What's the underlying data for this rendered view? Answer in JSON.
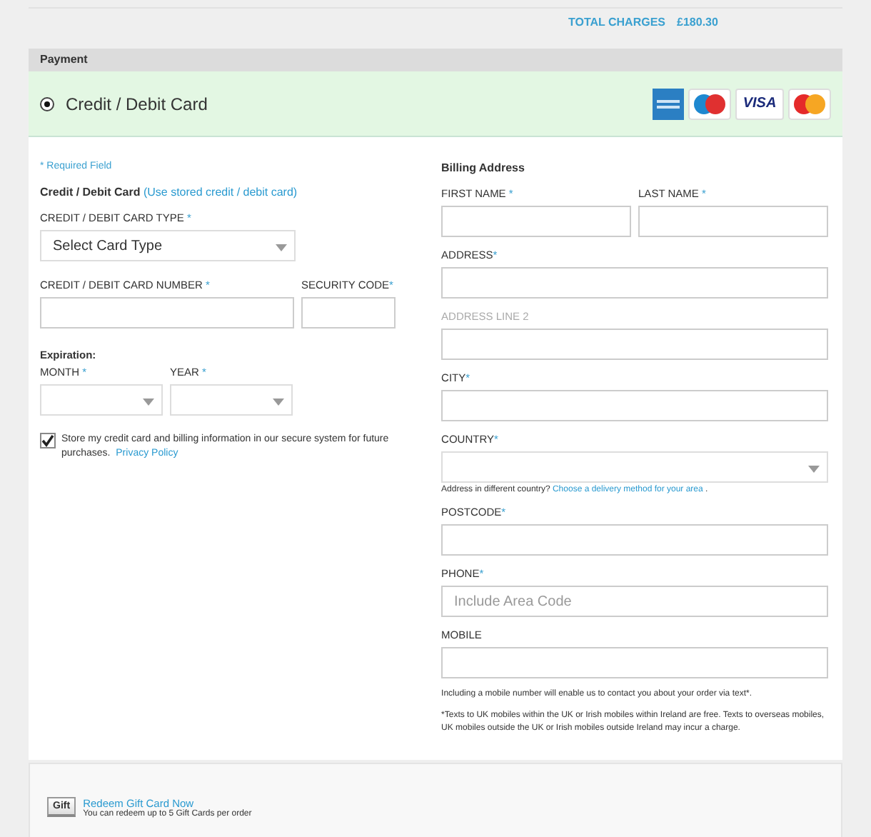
{
  "total": {
    "label": "TOTAL CHARGES",
    "amount": "£180.30"
  },
  "section_title": "Payment",
  "payment_option": {
    "label": "Credit / Debit Card",
    "selected": true,
    "logos": [
      {
        "kind": "amex"
      },
      {
        "kind": "maestro"
      },
      {
        "kind": "visa",
        "text": "VISA"
      },
      {
        "kind": "mastercard"
      }
    ]
  },
  "required_note": "* Required Field",
  "card": {
    "heading": "Credit / Debit Card",
    "stored_link": "(Use stored credit / debit card)",
    "type_field": {
      "label": "CREDIT / DEBIT CARD TYPE",
      "mark": "*",
      "value": "Select Card Type"
    },
    "number_field": {
      "label": "CREDIT / DEBIT CARD NUMBER",
      "mark": "*"
    },
    "security_field": {
      "label": "SECURITY CODE",
      "mark": "*"
    },
    "expiration": "Expiration:",
    "month_field": {
      "label": "MONTH",
      "mark": "*"
    },
    "year_field": {
      "label": "YEAR",
      "mark": "*"
    },
    "store": {
      "checked": true,
      "text": "Store my credit card and billing information in our secure system for future purchases.",
      "link": "Privacy Policy"
    }
  },
  "billing": {
    "heading": "Billing Address",
    "fields": [
      {
        "kind": "pair",
        "items": [
          {
            "label": "FIRST NAME",
            "mark": "*"
          },
          {
            "label": "LAST NAME",
            "mark": "*"
          }
        ]
      },
      {
        "kind": "input",
        "label": "ADDRESS",
        "mark": "*",
        "dimmed": false
      },
      {
        "kind": "input",
        "label": "ADDRESS LINE 2",
        "dimmed": true
      },
      {
        "kind": "input",
        "label": "CITY",
        "mark": "*",
        "dimmed": false
      },
      {
        "kind": "select",
        "label": "COUNTRY",
        "mark": "*",
        "dimmed": false
      },
      {
        "kind": "note",
        "text": "Address in different country?",
        "link": "Choose a delivery method for your area",
        "after": "."
      },
      {
        "kind": "input",
        "label": "POSTCODE",
        "mark": "*",
        "dimmed": false
      },
      {
        "kind": "input",
        "label": "PHONE",
        "mark": "*",
        "placeholder": "Include Area Code",
        "dimmed": false
      },
      {
        "kind": "input",
        "label": "MOBILE",
        "dimmed": false
      }
    ],
    "notes": [
      "Including a mobile number will enable us to contact you about your order via text*.",
      "*Texts to UK mobiles within the UK or Irish mobiles within Ireland are free. Texts to overseas mobiles, UK mobiles outside the UK or Irish mobiles outside Ireland may incur a charge."
    ]
  },
  "gift": {
    "badge": "Gift",
    "link": "Redeem Gift Card Now",
    "text": "You can redeem up to 5 Gift Cards per order"
  }
}
